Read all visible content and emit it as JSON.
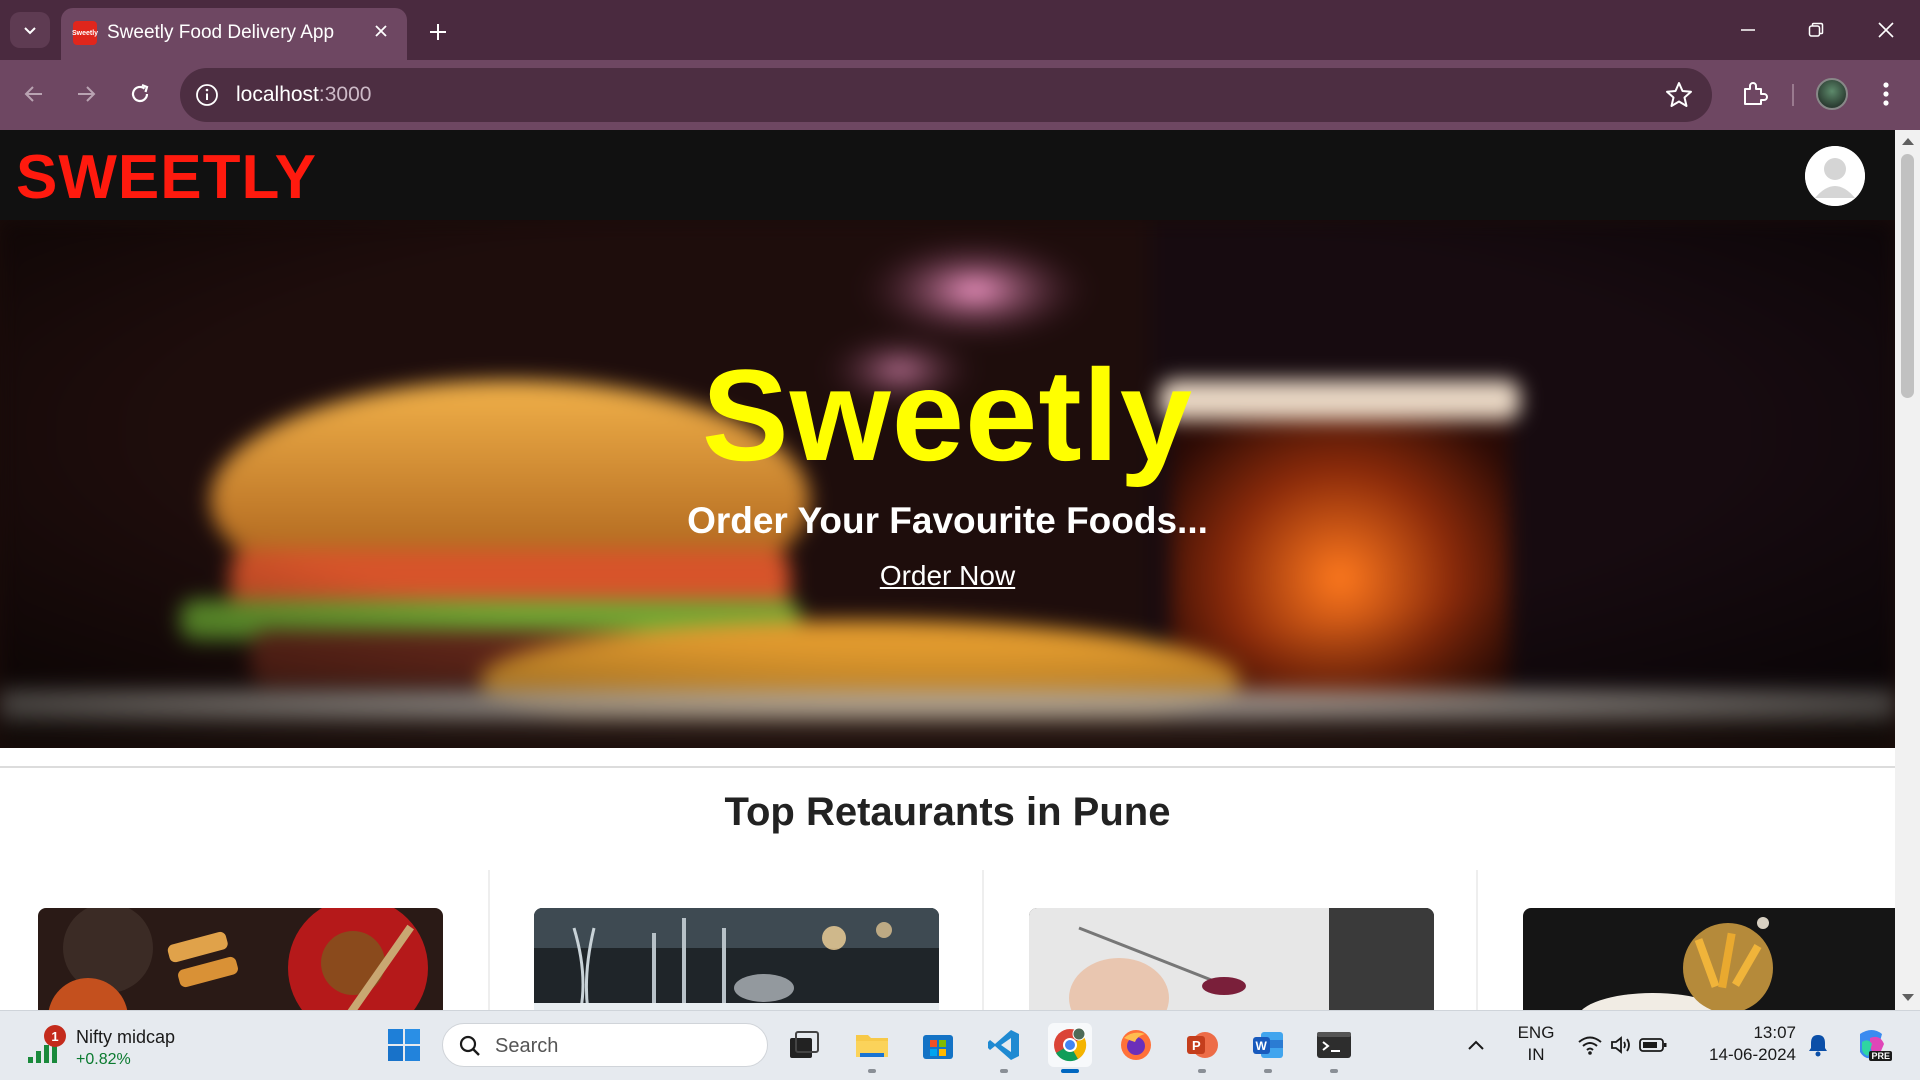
{
  "browser": {
    "tab_title": "Sweetly Food Delivery App",
    "favicon_text": "Sweetly",
    "url_host": "localhost",
    "url_port": ":3000",
    "icons": [
      "tab-search-icon",
      "close-icon",
      "plus-icon",
      "minimize-icon",
      "restore-icon",
      "close-window-icon",
      "back-icon",
      "forward-icon",
      "reload-icon",
      "info-icon",
      "star-icon",
      "extensions-icon",
      "profile-avatar",
      "menu-icon"
    ]
  },
  "site": {
    "brand": "SWEETLY",
    "hero": {
      "title": "Sweetly",
      "subtitle": "Order Your Favourite Foods...",
      "cta": "Order Now"
    },
    "section_title": "Top Retaurants in Pune",
    "colors": {
      "brand": "#ff1a0e",
      "hero_title": "#ffff00",
      "nav_bg": "#111111"
    }
  },
  "taskbar": {
    "widget_badge": "1",
    "widget_name": "Nifty midcap",
    "widget_value": "+0.82%",
    "search_placeholder": "Search",
    "lang_line1": "ENG",
    "lang_line2": "IN",
    "time": "13:07",
    "date": "14-06-2024",
    "copilot_badge": "PRE"
  }
}
